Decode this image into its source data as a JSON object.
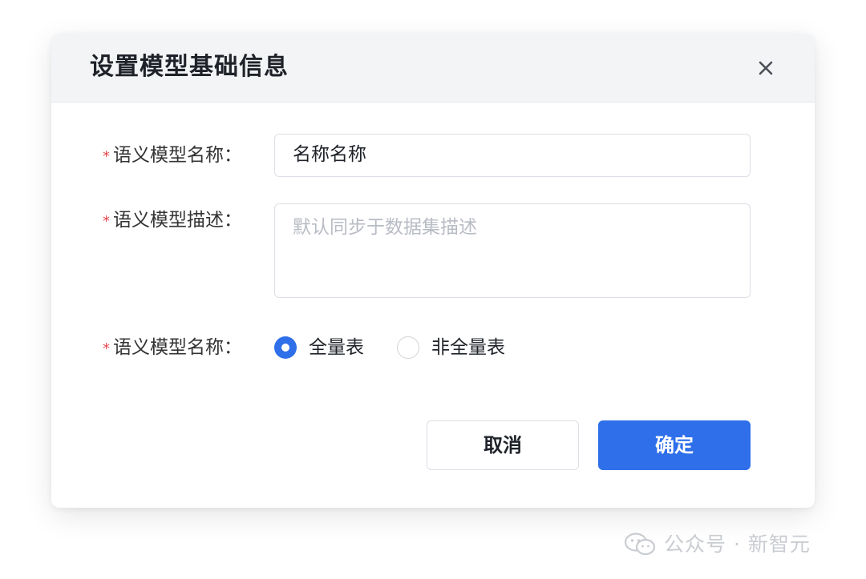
{
  "dialog": {
    "title": "设置模型基础信息",
    "close_icon": "close-icon"
  },
  "form": {
    "required_mark": "*",
    "name_field": {
      "label": "语义模型名称：",
      "value": "名称名称"
    },
    "description_field": {
      "label": "语义模型描述：",
      "placeholder": "默认同步于数据集描述",
      "value": ""
    },
    "table_type_field": {
      "label": "语义模型名称：",
      "options": [
        {
          "label": "全量表",
          "checked": true
        },
        {
          "label": "非全量表",
          "checked": false
        }
      ]
    }
  },
  "footer": {
    "cancel_label": "取消",
    "confirm_label": "确定"
  },
  "watermark": {
    "icon": "wechat-icon",
    "text": "公众号 · 新智元"
  },
  "colors": {
    "primary": "#2f6fea",
    "required": "#e5484d",
    "header_bg": "#f3f4f6",
    "placeholder": "#b8bcc4"
  }
}
